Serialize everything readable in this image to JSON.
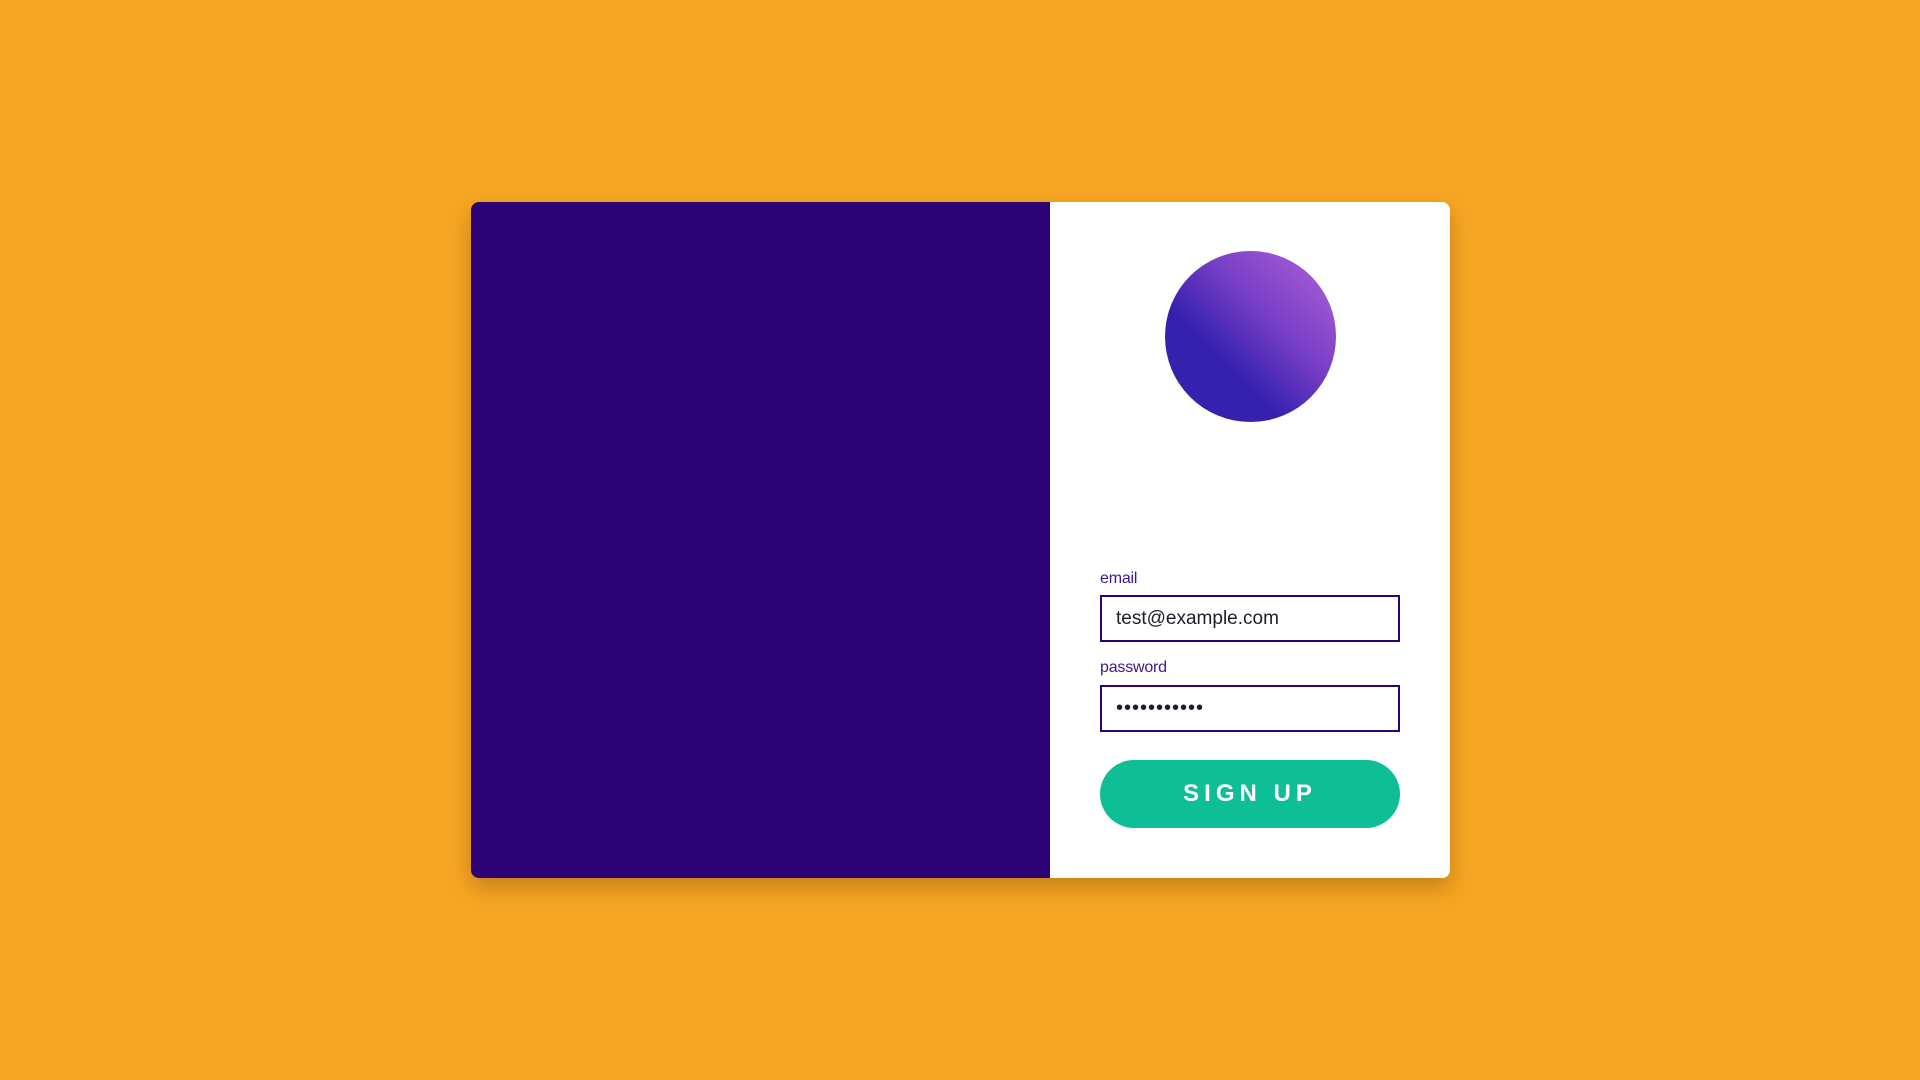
{
  "form": {
    "email_label": "email",
    "email_value": "test@example.com",
    "password_label": "password",
    "password_value": "•••••••••••",
    "submit_label": "SIGN UP"
  },
  "colors": {
    "background": "#f5a623",
    "left_panel": "#2d0274",
    "card": "#ffffff",
    "input_border": "#2d0274",
    "button": "#0ebe96",
    "logo_gradient": [
      "#3321ad",
      "#b066d8"
    ]
  },
  "icons": {
    "logo": "gradient-circle-logo"
  }
}
